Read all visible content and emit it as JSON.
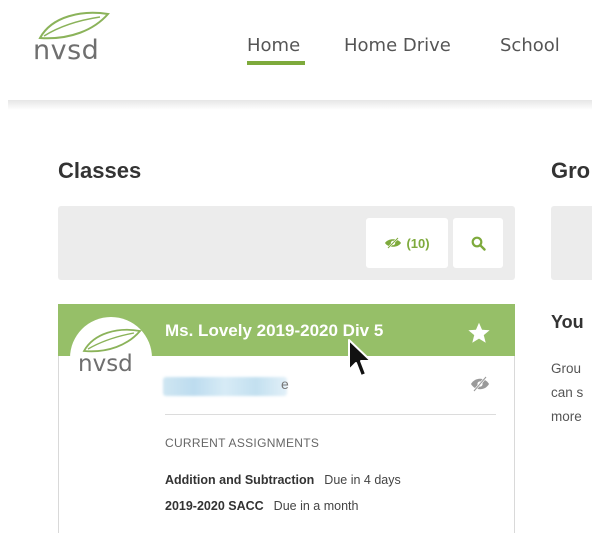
{
  "brand": {
    "logo_text": "nvsd"
  },
  "nav": {
    "items": [
      {
        "label": "Home"
      },
      {
        "label": "Home Drive"
      },
      {
        "label": "School"
      }
    ],
    "active": "Home"
  },
  "classes": {
    "title": "Classes",
    "hidden_count_label": "(10)",
    "card": {
      "title": "Ms. Lovely 2019-2020 Div 5",
      "teacher_name_suffix": "e",
      "assignments_label": "CURRENT ASSIGNMENTS",
      "assignments": [
        {
          "name": "Addition and Subtraction",
          "due": "Due in 4 days"
        },
        {
          "name": "2019-2020 SACC",
          "due": "Due in a month"
        }
      ]
    }
  },
  "groups": {
    "title": "Gro",
    "subtitle": "You",
    "lines": [
      "Grou",
      "can s",
      "more"
    ]
  },
  "colors": {
    "accent": "#7eaa3c",
    "card_header": "#96bf68",
    "toolbar_bg": "#ececec"
  },
  "icons": [
    "leaf-logo-icon",
    "eye-slash-icon",
    "search-icon",
    "star-icon",
    "mouse-pointer-icon"
  ]
}
